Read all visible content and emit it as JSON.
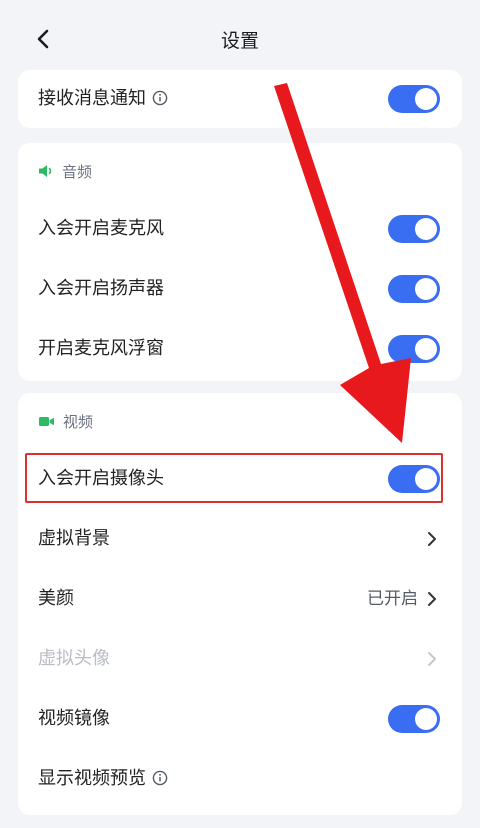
{
  "header": {
    "title": "设置",
    "back_icon": "chevron-left-icon"
  },
  "notifications": {
    "label": "接收消息通知",
    "toggle_on": true,
    "info_icon": "info-icon"
  },
  "audio": {
    "heading": "音频",
    "heading_icon": "speaker-icon",
    "heading_icon_color": "#2fb866",
    "items": [
      {
        "label": "入会开启麦克风",
        "toggle_on": true
      },
      {
        "label": "入会开启扬声器",
        "toggle_on": true
      },
      {
        "label": "开启麦克风浮窗",
        "toggle_on": true
      }
    ]
  },
  "video": {
    "heading": "视频",
    "heading_icon": "video-camera-icon",
    "heading_icon_color": "#2fb866",
    "items": [
      {
        "label": "入会开启摄像头",
        "toggle_on": true,
        "highlighted": true
      },
      {
        "label": "虚拟背景",
        "chevron": true
      },
      {
        "label": "美颜",
        "value": "已开启",
        "chevron": true
      },
      {
        "label": "虚拟头像",
        "chevron": true,
        "disabled": true
      },
      {
        "label": "视频镜像",
        "toggle_on": true
      },
      {
        "label": "显示视频预览",
        "info_icon": "info-icon"
      }
    ]
  },
  "colors": {
    "accent": "#3a6ef2",
    "annotation_arrow": "#e8191c",
    "highlight_border": "#d9312f",
    "background": "#f3f4f7"
  }
}
